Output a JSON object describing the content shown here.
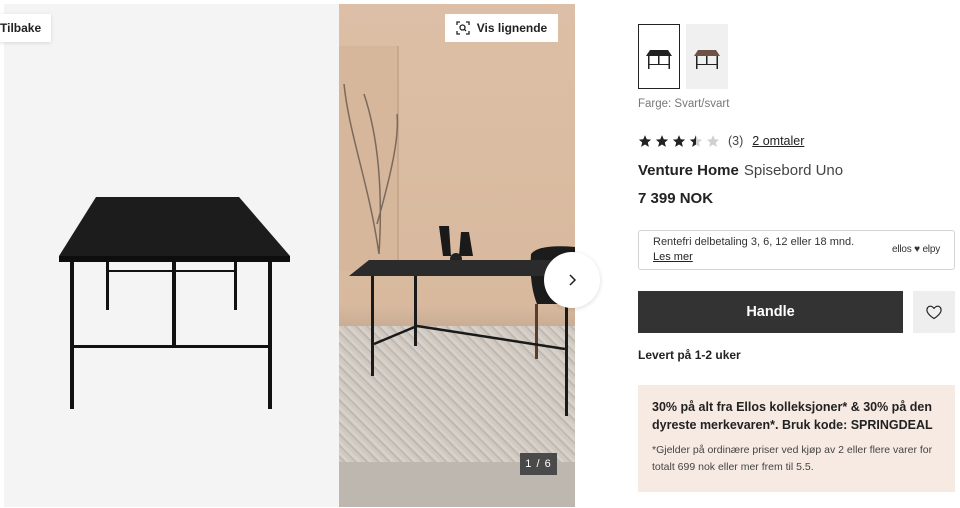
{
  "gallery": {
    "back_label": "Tilbake",
    "similar_label": "Vis lignende",
    "counter": "1 / 6"
  },
  "product": {
    "color_label": "Farge: Svart/svart",
    "rating": 3.5,
    "rating_count": "(3)",
    "reviews_link": "2 omtaler",
    "brand": "Venture Home",
    "name": "Spisebord Uno",
    "price": "7 399 NOK"
  },
  "finance": {
    "text": "Rentefri delbetaling 3, 6, 12 eller 18 mnd.",
    "link": "Les mer",
    "logo": "ellos ♥ elpy"
  },
  "actions": {
    "buy_label": "Handle",
    "delivery": "Levert på 1-2 uker"
  },
  "promo": {
    "headline": "30% på alt fra Ellos kolleksjoner* & 30% på den dyreste merkevaren*. Bruk kode: SPRINGDEAL",
    "terms": "*Gjelder på ordinære priser ved kjøp av 2 eller flere varer for totalt 699 nok eller mer frem til 5.5."
  },
  "icons": [
    "scan-icon",
    "chevron-right-icon",
    "star-icon",
    "heart-icon"
  ],
  "colors": {
    "button_dark": "#333333",
    "promo_bg": "#f6eae3"
  }
}
